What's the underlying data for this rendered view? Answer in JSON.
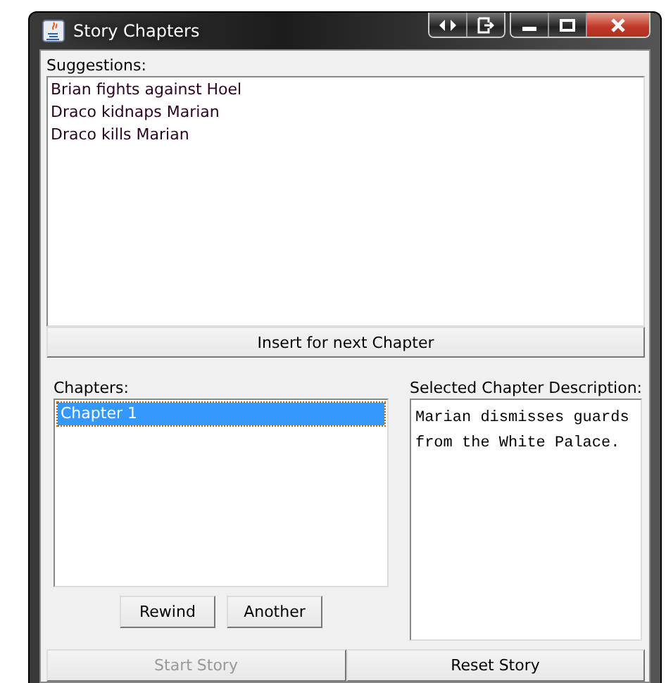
{
  "window": {
    "title": "Story Chapters"
  },
  "suggestions": {
    "label": "Suggestions:",
    "items": [
      "Brian fights against Hoel",
      "Draco kidnaps Marian",
      "Draco kills Marian"
    ]
  },
  "insert_button": {
    "label": "Insert for next Chapter",
    "disabled": false
  },
  "chapters": {
    "label": "Chapters:",
    "items": [
      {
        "text": "Chapter 1",
        "selected": true
      }
    ]
  },
  "chapter_buttons": [
    {
      "label": "Rewind",
      "disabled": false
    },
    {
      "label": "Another",
      "disabled": false
    }
  ],
  "description": {
    "label": "Selected Chapter Description:",
    "text": "Marian dismisses guards from the White Palace."
  },
  "story_buttons": [
    {
      "label": "Start Story",
      "disabled": true
    },
    {
      "label": "Reset Story",
      "disabled": false
    }
  ]
}
